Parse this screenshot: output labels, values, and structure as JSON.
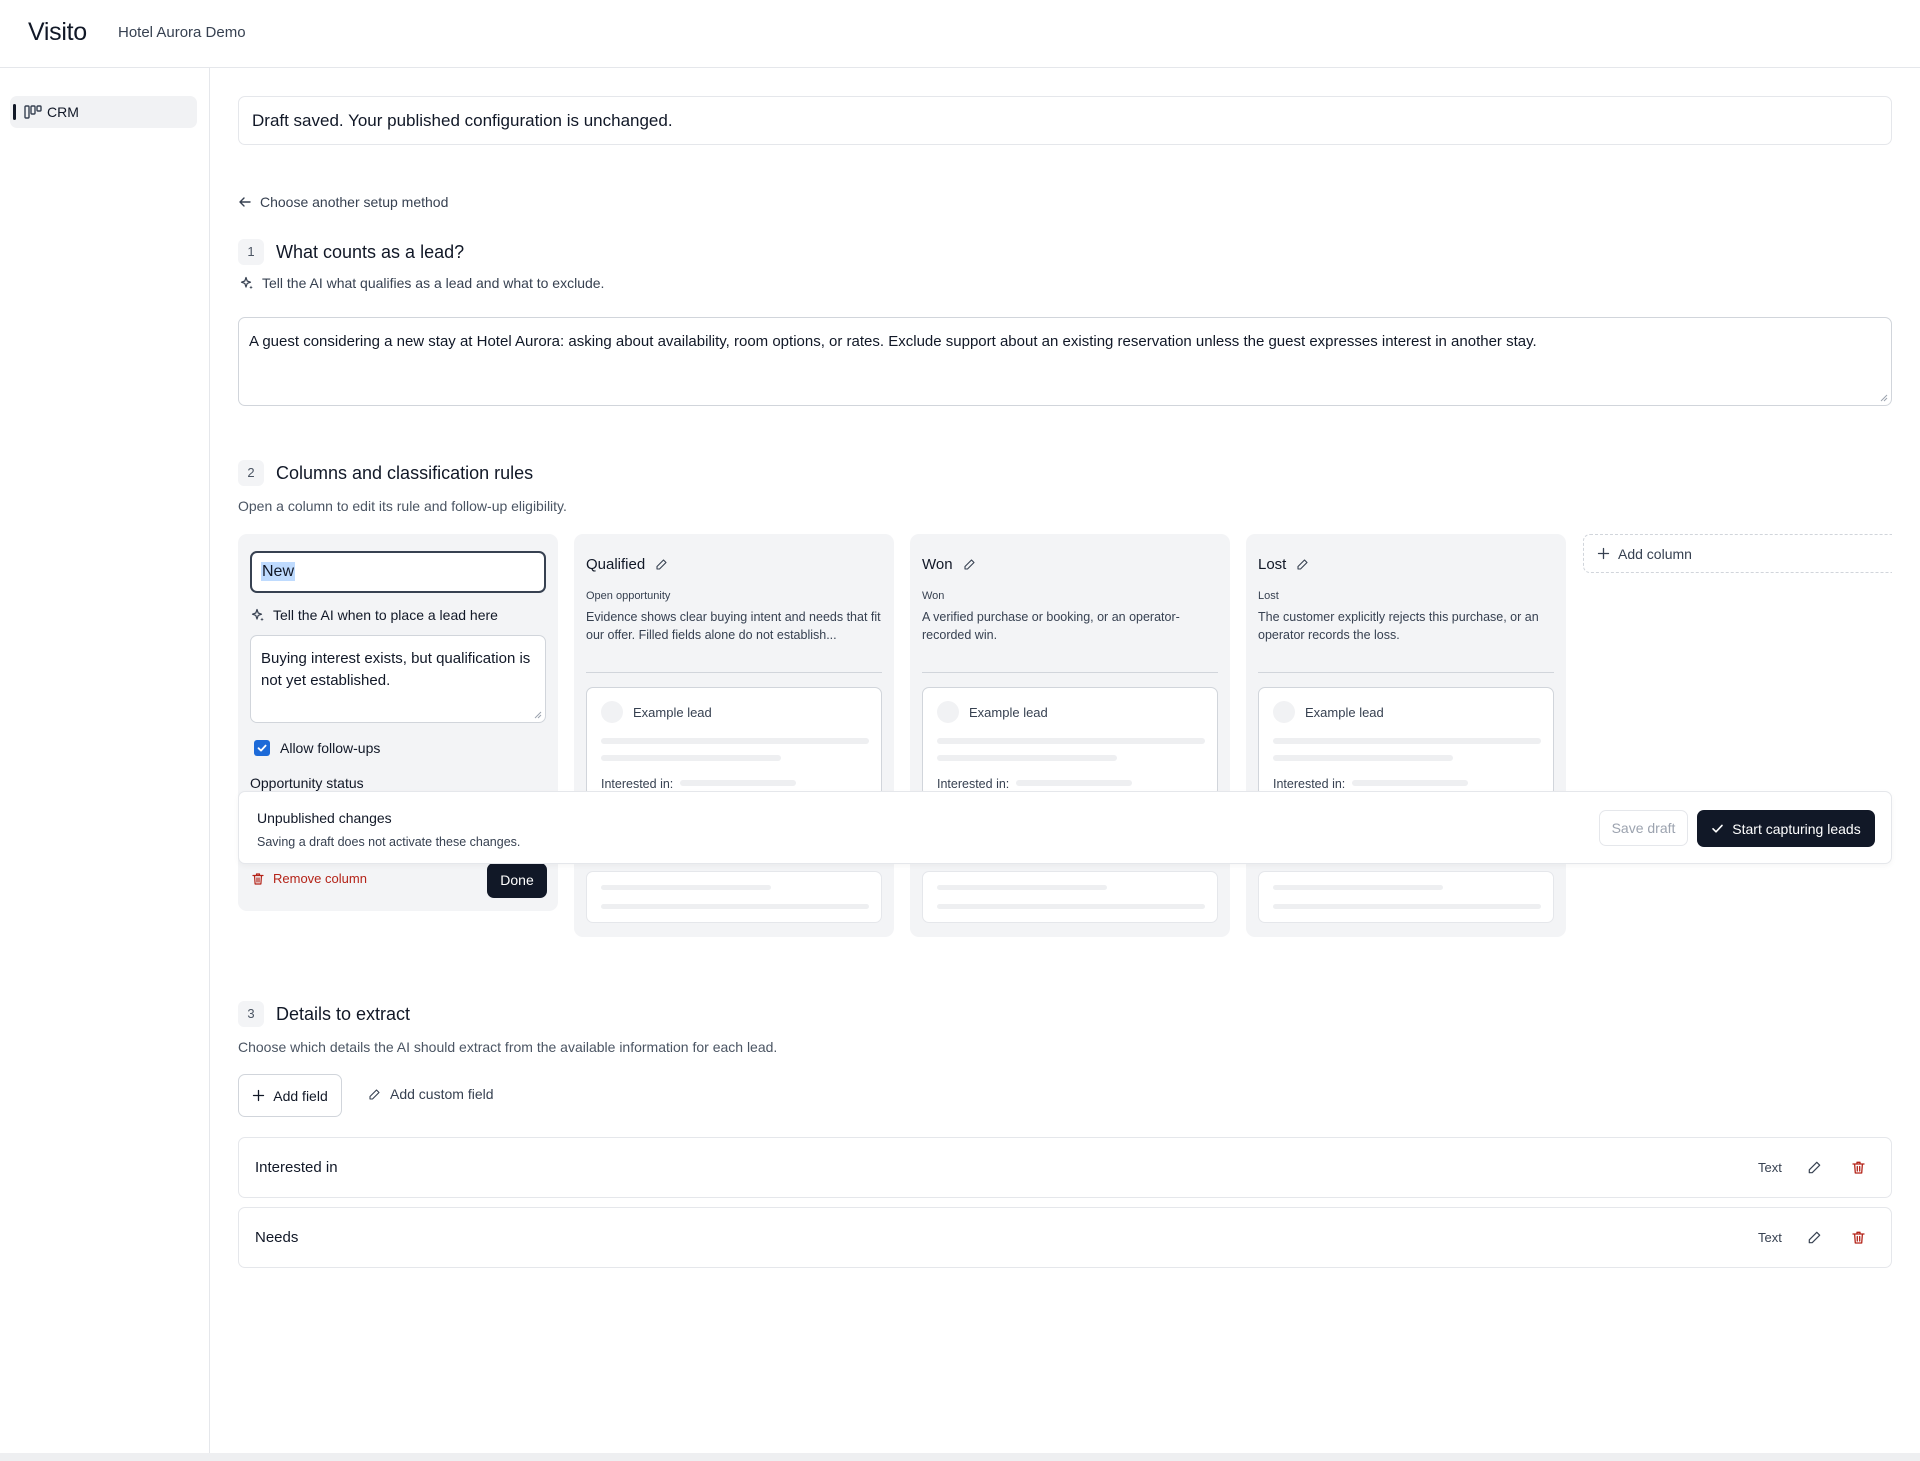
{
  "header": {
    "brand": "Visito",
    "workspace": "Hotel Aurora Demo"
  },
  "sidebar": {
    "items": [
      {
        "label": "CRM",
        "icon": "crm-icon"
      }
    ]
  },
  "notice": {
    "text": "Draft saved. Your published configuration is unchanged."
  },
  "back_link": {
    "label": "Choose another setup method",
    "icon": "arrow-left-icon"
  },
  "section1": {
    "number": "1",
    "title": "What counts as a lead?",
    "hint": "Tell the AI what qualifies as a lead and what to exclude.",
    "definition": "A guest considering a new stay at Hotel Aurora: asking about availability, room options, or rates. Exclude support about an existing reservation unless the guest expresses interest in another stay."
  },
  "section2": {
    "number": "2",
    "title": "Columns and classification rules",
    "subtitle": "Open a column to edit its rule and follow-up eligibility.",
    "editing_column": {
      "name_value": "New",
      "hint": "Tell the AI when to place a lead here",
      "rule": "Buying interest exists, but qualification is not yet established.",
      "allow_followups_label": "Allow follow-ups",
      "allow_followups_checked": true,
      "opportunity_status_label": "Opportunity status",
      "remove_label": "Remove column",
      "done_label": "Done"
    },
    "columns": [
      {
        "name": "Qualified",
        "tag": "Open opportunity",
        "description": "Evidence shows clear buying intent and needs that fit our offer. Filled fields alone do not establish...",
        "example_lead": "Example lead",
        "interested_label": "Interested in:"
      },
      {
        "name": "Won",
        "tag": "Won",
        "description": "A verified purchase or booking, or an operator-recorded win.",
        "example_lead": "Example lead",
        "interested_label": "Interested in:"
      },
      {
        "name": "Lost",
        "tag": "Lost",
        "description": "The customer explicitly rejects this purchase, or an operator records the loss.",
        "example_lead": "Example lead",
        "interested_label": "Interested in:"
      }
    ],
    "add_column_label": "Add column"
  },
  "publish_bar": {
    "title": "Unpublished changes",
    "subtitle": "Saving a draft does not activate these changes.",
    "save_label": "Save draft",
    "start_label": "Start capturing leads"
  },
  "section3": {
    "number": "3",
    "title": "Details to extract",
    "subtitle": "Choose which details the AI should extract from the available information for each lead.",
    "add_field_label": "Add field",
    "add_custom_label": "Add custom field",
    "fields": [
      {
        "name": "Interested in",
        "type": "Text"
      },
      {
        "name": "Needs",
        "type": "Text"
      }
    ]
  },
  "colors": {
    "primary": "#111827",
    "danger": "#b42318",
    "checkbox": "#1d6ad8",
    "column_bg": "#f3f4f6",
    "border": "#e5e7eb"
  }
}
